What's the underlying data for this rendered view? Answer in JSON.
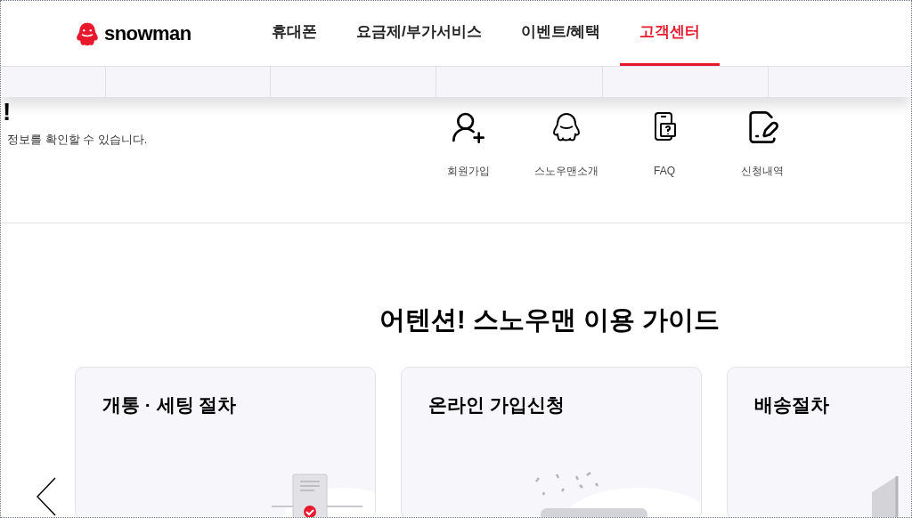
{
  "header": {
    "logo": "snowman",
    "nav": [
      {
        "label": "휴대폰",
        "selected": false
      },
      {
        "label": "요금제/부가서비스",
        "selected": false
      },
      {
        "label": "이벤트/혜택",
        "selected": false
      },
      {
        "label": "고객센터",
        "selected": true
      }
    ]
  },
  "hero": {
    "title": "!",
    "subtitle": "정보를 확인할 수 있습니다."
  },
  "quick_links": [
    {
      "kind": "signup",
      "label": "회원가입"
    },
    {
      "kind": "mascot",
      "label": "스노우맨소개"
    },
    {
      "kind": "faq",
      "label": "FAQ"
    },
    {
      "kind": "history",
      "label": "신청내역"
    }
  ],
  "guide": {
    "title": "어텐션! 스노우맨 이용 가이드",
    "cards": [
      {
        "kind": "setup",
        "title": "개통 · 세팅 절차"
      },
      {
        "kind": "online",
        "title": "온라인 가입신청"
      },
      {
        "kind": "delivery",
        "title": "배송절차"
      }
    ]
  }
}
